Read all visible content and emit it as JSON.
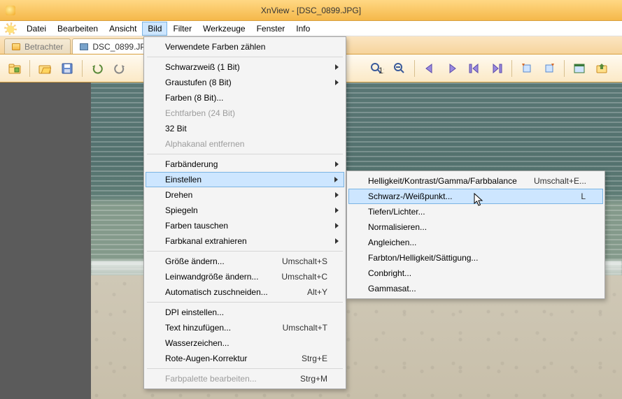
{
  "window": {
    "title": "XnView - [DSC_0899.JPG]"
  },
  "menubar": {
    "items": [
      "Datei",
      "Bearbeiten",
      "Ansicht",
      "Bild",
      "Filter",
      "Werkzeuge",
      "Fenster",
      "Info"
    ],
    "active_index": 3
  },
  "tabs": {
    "items": [
      {
        "label": "Betrachter",
        "active": false
      },
      {
        "label": "DSC_0899.JP",
        "active": true
      }
    ]
  },
  "menu_bild": {
    "sections": [
      [
        {
          "label": "Verwendete Farben zählen"
        }
      ],
      [
        {
          "label": "Schwarzweiß (1 Bit)",
          "submenu": true
        },
        {
          "label": "Graustufen (8 Bit)",
          "submenu": true
        },
        {
          "label": "Farben (8 Bit)..."
        },
        {
          "label": "Echtfarben (24 Bit)",
          "disabled": true
        },
        {
          "label": "32 Bit"
        },
        {
          "label": "Alphakanal entfernen",
          "disabled": true
        }
      ],
      [
        {
          "label": "Farbänderung",
          "submenu": true
        },
        {
          "label": "Einstellen",
          "submenu": true,
          "highlight": true
        },
        {
          "label": "Drehen",
          "submenu": true
        },
        {
          "label": "Spiegeln",
          "submenu": true
        },
        {
          "label": "Farben tauschen",
          "submenu": true
        },
        {
          "label": "Farbkanal extrahieren",
          "submenu": true
        }
      ],
      [
        {
          "label": "Größe ändern...",
          "shortcut": "Umschalt+S"
        },
        {
          "label": "Leinwandgröße ändern...",
          "shortcut": "Umschalt+C"
        },
        {
          "label": "Automatisch zuschneiden...",
          "shortcut": "Alt+Y"
        }
      ],
      [
        {
          "label": "DPI einstellen..."
        },
        {
          "label": "Text hinzufügen...",
          "shortcut": "Umschalt+T"
        },
        {
          "label": "Wasserzeichen..."
        },
        {
          "label": "Rote-Augen-Korrektur",
          "shortcut": "Strg+E"
        }
      ],
      [
        {
          "label": "Farbpalette bearbeiten...",
          "shortcut": "Strg+M",
          "disabled": true
        }
      ]
    ]
  },
  "submenu_einstellen": {
    "items": [
      {
        "label": "Helligkeit/Kontrast/Gamma/Farbbalance",
        "shortcut": "Umschalt+E..."
      },
      {
        "label": "Schwarz-/Weißpunkt...",
        "shortcut": "L",
        "highlight": true
      },
      {
        "label": "Tiefen/Lichter..."
      },
      {
        "label": "Normalisieren..."
      },
      {
        "label": "Angleichen..."
      },
      {
        "label": "Farbton/Helligkeit/Sättigung..."
      },
      {
        "label": "Conbright..."
      },
      {
        "label": "Gammasat..."
      }
    ]
  },
  "toolbar": {
    "buttons": [
      "browse",
      "open",
      "save",
      "undo",
      "redo",
      "cut",
      "copy",
      "paste",
      "zoom-fit",
      "zoom-1to1",
      "zoom-out",
      "prev",
      "next",
      "first",
      "last",
      "rotate-left",
      "rotate-right",
      "fullscreen",
      "export"
    ]
  }
}
